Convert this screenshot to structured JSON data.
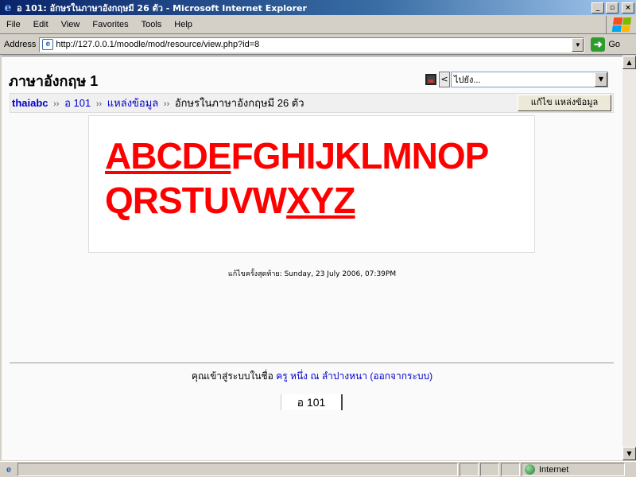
{
  "window": {
    "title": "อ 101: อักษรในภาษาอังกฤษมี 26 ตัว - Microsoft Internet Explorer",
    "min_glyph": "_",
    "max_glyph": "▫",
    "close_glyph": "×"
  },
  "menu": [
    "File",
    "Edit",
    "View",
    "Favorites",
    "Tools",
    "Help"
  ],
  "address": {
    "label": "Address",
    "url": "http://127.0.0.1/moodle/mod/resource/view.php?id=8",
    "go_label": "Go"
  },
  "page": {
    "course_title": "ภาษาอังกฤษ 1",
    "jump_select_value": "ไปยัง...",
    "breadcrumb": {
      "home": "thaiabc",
      "course": "อ 101",
      "section": "แหล่งข้อมูล",
      "current": "อักษรในภาษาอังกฤษมี 26 ตัว",
      "separator": "››"
    },
    "edit_button_label": "แก้ไข แหล่งข้อมูล",
    "content": {
      "line1_underlined": "ABCDE",
      "line1_rest": "FGHIJKLMNOP",
      "line2_plain": "QRSTUVW",
      "line2_underlined": "XYZ"
    },
    "modified_label": "แก้ไขครั้งสุดท้าย:",
    "modified_date": "Sunday, 23 July 2006, 07:39PM",
    "login": {
      "prefix": "คุณเข้าสู่ระบบในชื่อ",
      "user": "ครู หนึ่ง ณ ลำปางหนา",
      "logout": "(ออกจากระบบ)"
    },
    "footer_course_button": "อ 101"
  },
  "status": {
    "zone": "Internet"
  },
  "colors": {
    "link": "#0000cc",
    "content_text": "#ff0000",
    "titlebar": "#0a246a"
  },
  "icons": [
    "ie-logo-icon",
    "windows-flag-icon",
    "page-icon",
    "go-arrow-icon",
    "save-icon",
    "globe-icon"
  ]
}
